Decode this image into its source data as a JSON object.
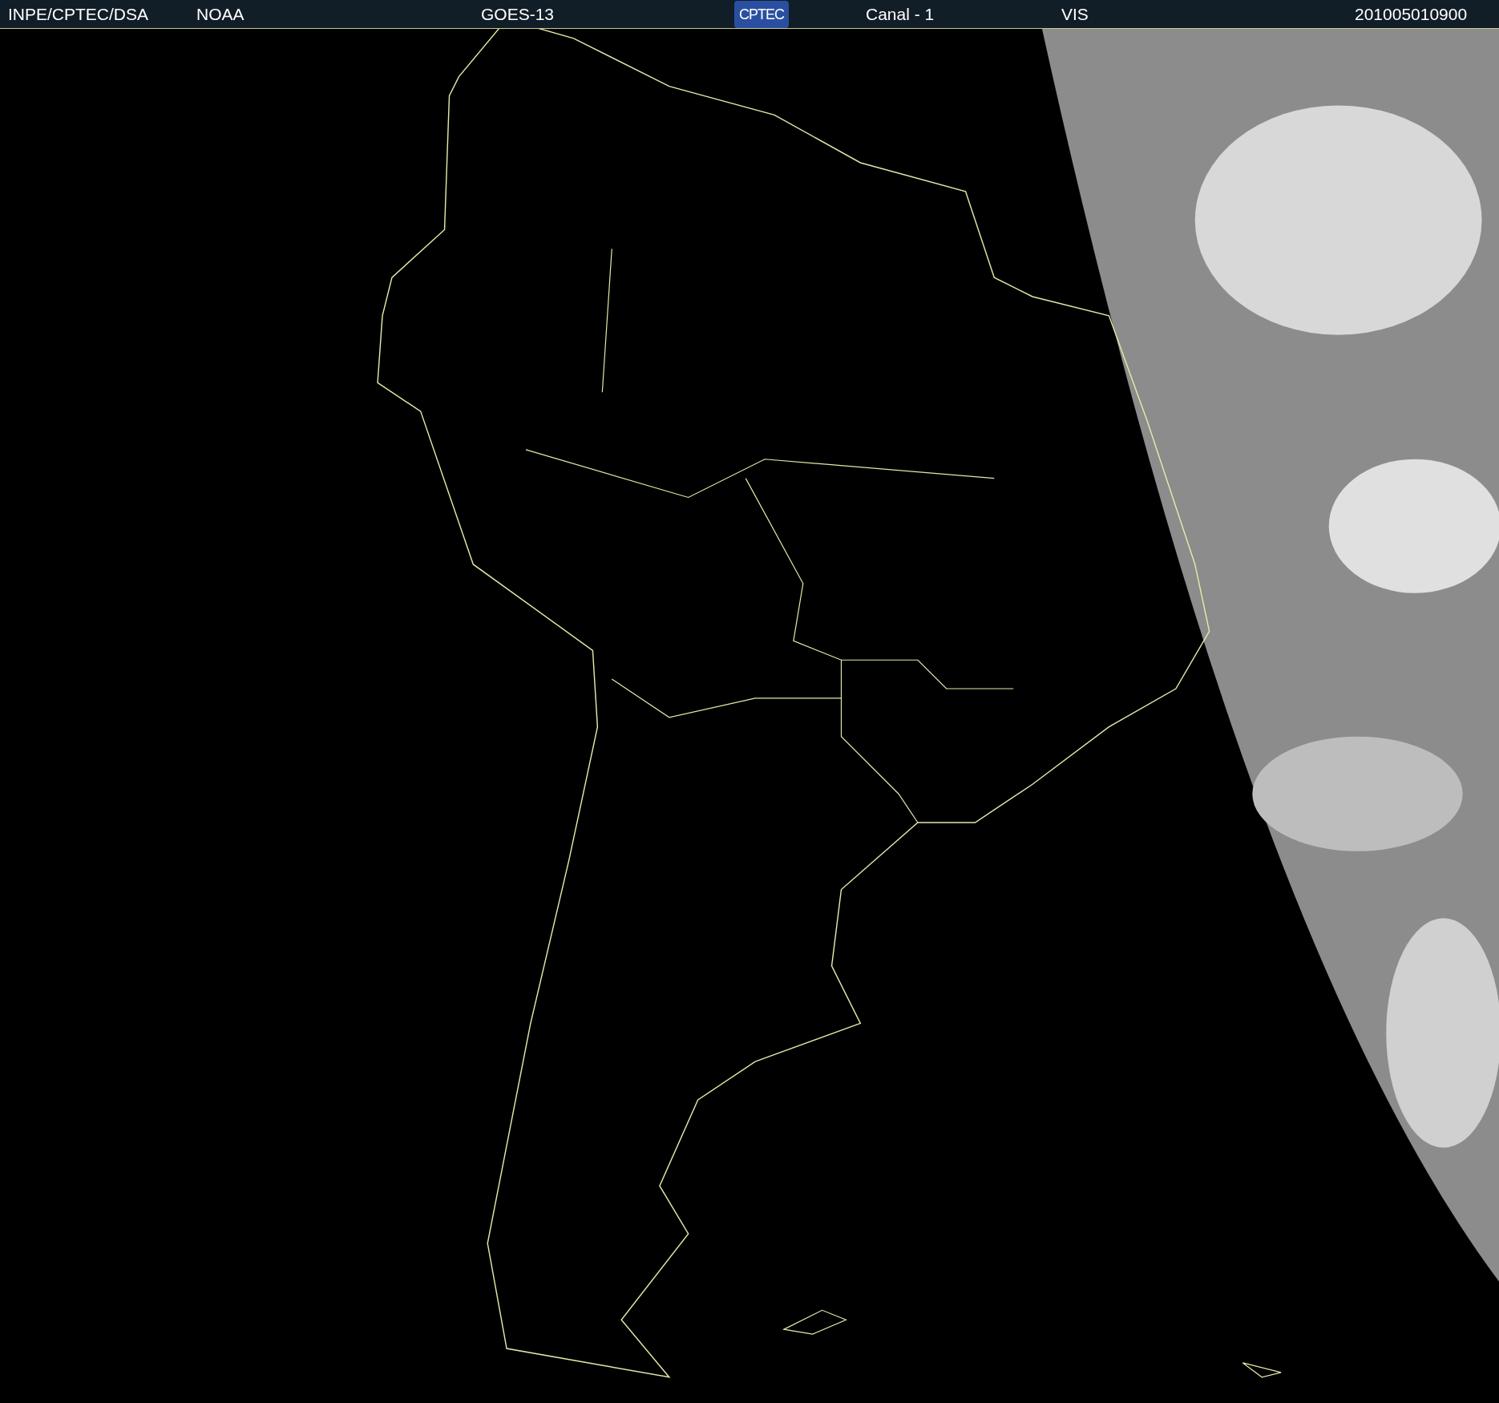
{
  "header": {
    "items": [
      {
        "kind": "text",
        "text": "INPE/CPTEC/DSA"
      },
      {
        "kind": "text",
        "text": "NOAA"
      },
      {
        "kind": "text",
        "text": "GOES-13"
      },
      {
        "kind": "logo",
        "text": "CPTEC"
      },
      {
        "kind": "text",
        "text": "Canal - 1"
      },
      {
        "kind": "text",
        "text": "VIS"
      },
      {
        "kind": "text",
        "text": "201005010900"
      }
    ]
  }
}
